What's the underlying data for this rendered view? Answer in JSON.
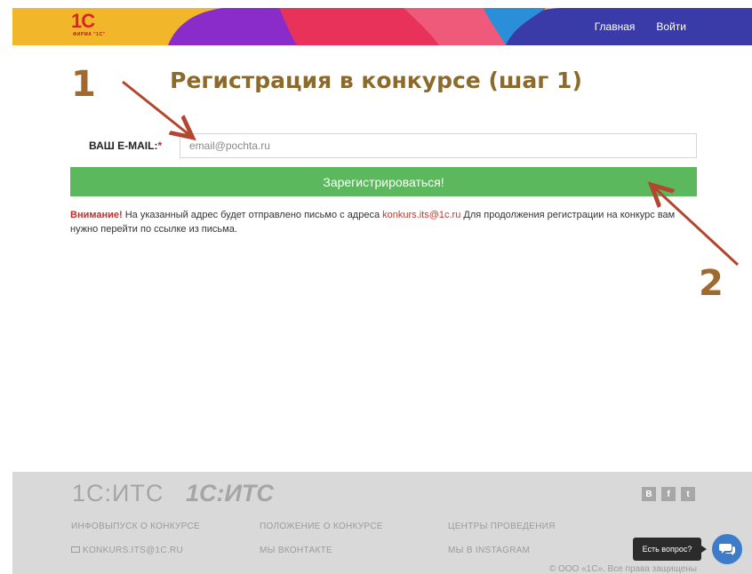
{
  "header": {
    "logo_mark": "1С",
    "logo_sub": "ФИРМА \"1С\"",
    "nav": [
      "Главная",
      "Войти"
    ]
  },
  "annotations": {
    "step1": "1",
    "step2": "2"
  },
  "main": {
    "title": "Регистрация в конкурсе (шаг 1)",
    "email_label": "ВАШ E-MAIL:",
    "email_required": "*",
    "email_placeholder": "email@pochta.ru",
    "email_value": "",
    "submit_label": "Зарегистрироваться!",
    "notice_warn": "Внимание!",
    "notice_before": " На указанный адрес будет отправлено письмо с адреса ",
    "notice_email": "konkurs.its@1c.ru",
    "notice_after": " Для продолжения регистрации на конкурс вам нужно перейти по ссылке из письма."
  },
  "footer": {
    "brand_text": "1С:ИТС",
    "brand_logo": "1С:ИТС",
    "socials": [
      "В",
      "f",
      "t"
    ],
    "links": {
      "info": "Инфовыпуск о конкурсе",
      "rules": "Положение о конкурсе",
      "centers": "Центры проведения",
      "email": "konkurs.its@1c.ru",
      "vk": "Мы ВКонтакте",
      "instagram": "Мы в Instagram"
    },
    "copyright": "© ООО «1С». Все права защищены",
    "chat_tip": "Есть вопрос?"
  },
  "colors": {
    "accent_green": "#5cb85c",
    "title_brown": "#8b6a2c",
    "arrow": "#b2462e",
    "chat_blue": "#3d7cc9"
  }
}
